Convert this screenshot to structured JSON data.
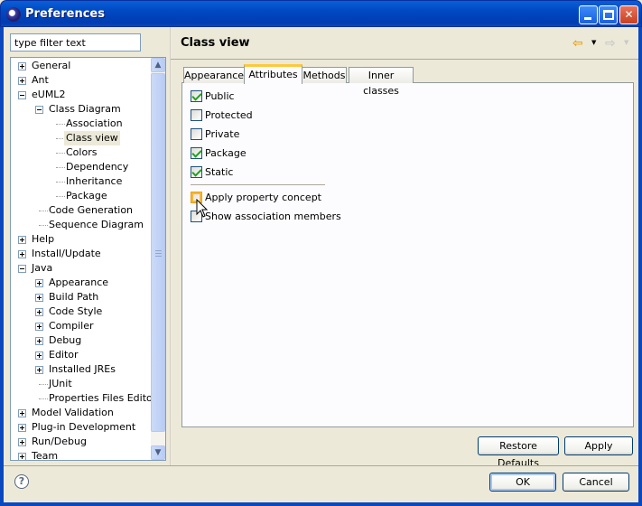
{
  "window": {
    "title": "Preferences",
    "icon": "eclipse-icon"
  },
  "filter": {
    "value": "type filter text"
  },
  "tree": [
    {
      "label": "General",
      "expander": "plus"
    },
    {
      "label": "Ant",
      "expander": "plus"
    },
    {
      "label": "eUML2",
      "expander": "minus"
    },
    {
      "label": "Class Diagram",
      "expander": "minus"
    },
    {
      "label": "Association"
    },
    {
      "label": "Class view",
      "selected": true
    },
    {
      "label": "Colors"
    },
    {
      "label": "Dependency"
    },
    {
      "label": "Inheritance"
    },
    {
      "label": "Package"
    },
    {
      "label": "Code Generation"
    },
    {
      "label": "Sequence Diagram"
    },
    {
      "label": "Help",
      "expander": "plus"
    },
    {
      "label": "Install/Update",
      "expander": "plus"
    },
    {
      "label": "Java",
      "expander": "minus"
    },
    {
      "label": "Appearance",
      "expander": "plus"
    },
    {
      "label": "Build Path",
      "expander": "plus"
    },
    {
      "label": "Code Style",
      "expander": "plus"
    },
    {
      "label": "Compiler",
      "expander": "plus"
    },
    {
      "label": "Debug",
      "expander": "plus"
    },
    {
      "label": "Editor",
      "expander": "plus"
    },
    {
      "label": "Installed JREs",
      "expander": "plus"
    },
    {
      "label": "JUnit"
    },
    {
      "label": "Properties Files Editor"
    },
    {
      "label": "Model Validation",
      "expander": "plus"
    },
    {
      "label": "Plug-in Development",
      "expander": "plus"
    },
    {
      "label": "Run/Debug",
      "expander": "plus"
    },
    {
      "label": "Team",
      "expander": "plus"
    }
  ],
  "page": {
    "title": "Class view"
  },
  "tabs": [
    {
      "label": "Appearance",
      "active": false
    },
    {
      "label": "Attributes",
      "active": true
    },
    {
      "label": "Methods",
      "active": false
    },
    {
      "label": "Inner classes",
      "active": false
    }
  ],
  "checkboxes": [
    {
      "label": "Public",
      "checked": true
    },
    {
      "label": "Protected",
      "checked": false
    },
    {
      "label": "Private",
      "checked": false
    },
    {
      "label": "Package",
      "checked": true
    },
    {
      "label": "Static",
      "checked": true
    },
    {
      "label": "Apply property concept",
      "checked": false
    },
    {
      "label": "Show association members",
      "checked": false
    }
  ],
  "buttons": {
    "restore_defaults": "Restore Defaults",
    "apply": "Apply",
    "ok": "OK",
    "cancel": "Cancel"
  },
  "help": {
    "symbol": "?"
  },
  "colors": {
    "titlebar": "#0a5fd8",
    "check": "#21a121",
    "active_tab": "#ffc83c"
  }
}
